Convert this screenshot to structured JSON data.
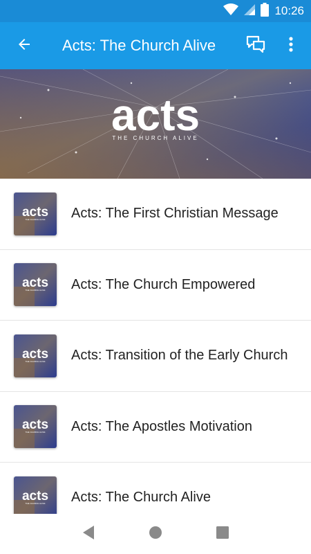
{
  "status_bar": {
    "time": "10:26",
    "icons": [
      "wifi-icon",
      "signal-icon",
      "battery-icon"
    ]
  },
  "app_bar": {
    "title": "Acts: The Church Alive",
    "back_icon": "arrow-back-icon",
    "chat_icon": "chat-icon",
    "menu_icon": "more-vert-icon"
  },
  "banner": {
    "logo_text": "acts",
    "tagline": "THE CHURCH ALIVE"
  },
  "thumbnail": {
    "logo_text": "acts",
    "tagline": "THE CHURCH ALIVE"
  },
  "items": [
    {
      "title": "Acts: The First Christian Message"
    },
    {
      "title": "Acts: The Church Empowered"
    },
    {
      "title": "Acts: Transition of the Early Church"
    },
    {
      "title": "Acts: The Apostles Motivation"
    },
    {
      "title": "Acts: The Church Alive"
    }
  ],
  "nav_bar": {
    "icons": [
      "back-triangle-icon",
      "home-circle-icon",
      "recents-square-icon"
    ]
  },
  "colors": {
    "primary": "#1a9ae6",
    "status_bar": "#1a8bd6",
    "text": "#222222",
    "divider": "#e4e4e4"
  }
}
